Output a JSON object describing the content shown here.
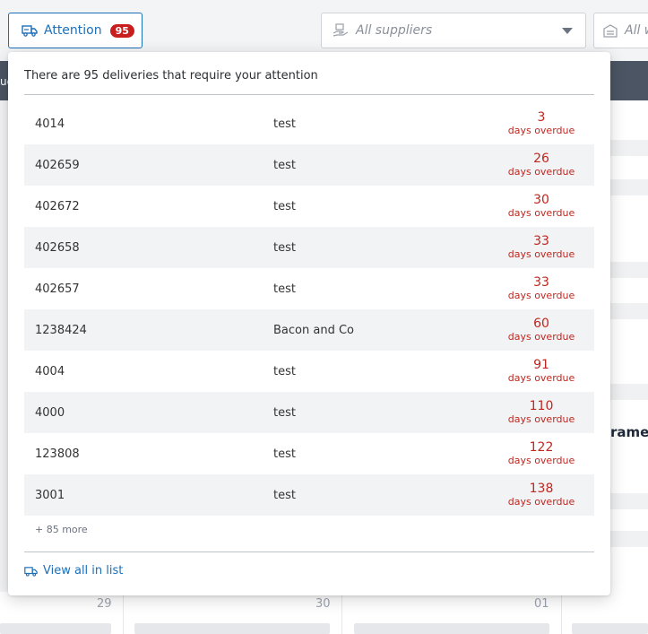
{
  "toolbar": {
    "attention_label": "Attention",
    "attention_count": "95",
    "supplier_placeholder": "All suppliers",
    "warehouse_placeholder": "All w"
  },
  "background": {
    "band_text": "ue",
    "frame_text": "rame",
    "calendar_days": [
      "29",
      "30",
      "01"
    ]
  },
  "popover": {
    "header": "There are 95 deliveries that require your attention",
    "rows": [
      {
        "id": "4014",
        "supplier": "test",
        "days": "3",
        "overdue_label": "days overdue"
      },
      {
        "id": "402659",
        "supplier": "test",
        "days": "26",
        "overdue_label": "days overdue"
      },
      {
        "id": "402672",
        "supplier": "test",
        "days": "30",
        "overdue_label": "days overdue"
      },
      {
        "id": "402658",
        "supplier": "test",
        "days": "33",
        "overdue_label": "days overdue"
      },
      {
        "id": "402657",
        "supplier": "test",
        "days": "33",
        "overdue_label": "days overdue"
      },
      {
        "id": "1238424",
        "supplier": "Bacon and Co",
        "days": "60",
        "overdue_label": "days overdue"
      },
      {
        "id": "4004",
        "supplier": "test",
        "days": "91",
        "overdue_label": "days overdue"
      },
      {
        "id": "4000",
        "supplier": "test",
        "days": "110",
        "overdue_label": "days overdue"
      },
      {
        "id": "123808",
        "supplier": "test",
        "days": "122",
        "overdue_label": "days overdue"
      },
      {
        "id": "3001",
        "supplier": "test",
        "days": "138",
        "overdue_label": "days overdue"
      }
    ],
    "more_text": "+ 85 more",
    "view_all_label": "View all in list"
  },
  "colors": {
    "accent": "#1d6fb8",
    "overdue": "#c0261f",
    "badge": "#c81e1e"
  }
}
